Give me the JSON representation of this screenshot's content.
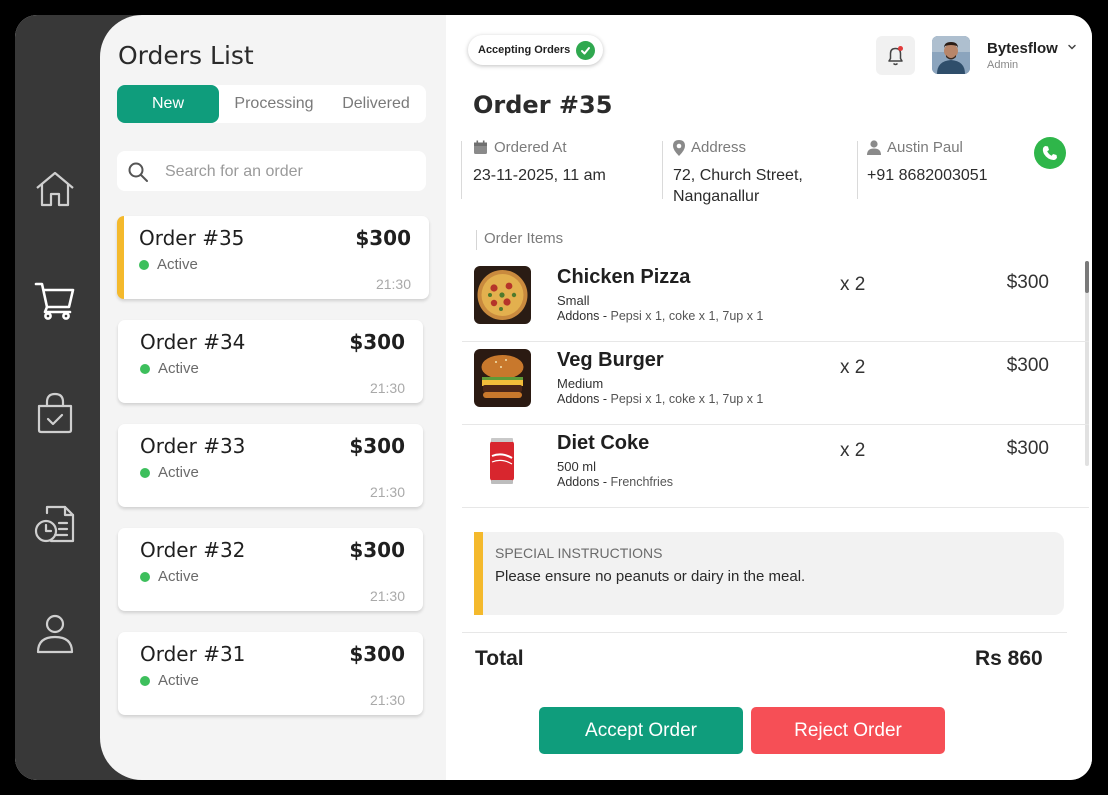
{
  "nav": {
    "items": [
      "home",
      "cart",
      "bag",
      "reports",
      "profile"
    ]
  },
  "orders_list": {
    "title": "Orders List",
    "tabs": [
      {
        "label": "New",
        "active": true
      },
      {
        "label": "Processing",
        "active": false
      },
      {
        "label": "Delivered",
        "active": false
      }
    ],
    "search_placeholder": "Search for an order",
    "orders": [
      {
        "title": "Order #35",
        "price": "$300",
        "status": "Active",
        "time": "21:30",
        "selected": true
      },
      {
        "title": "Order #34",
        "price": "$300",
        "status": "Active",
        "time": "21:30",
        "selected": false
      },
      {
        "title": "Order #33",
        "price": "$300",
        "status": "Active",
        "time": "21:30",
        "selected": false
      },
      {
        "title": "Order #32",
        "price": "$300",
        "status": "Active",
        "time": "21:30",
        "selected": false
      },
      {
        "title": "Order #31",
        "price": "$300",
        "status": "Active",
        "time": "21:30",
        "selected": false
      }
    ]
  },
  "header": {
    "accepting_label": "Accepting Orders",
    "user_name": "Bytesflow",
    "user_role": "Admin"
  },
  "detail": {
    "order_title": "Order #35",
    "ordered_at_label": "Ordered At",
    "ordered_at_value": "23-11-2025, 11 am",
    "address_label": "Address",
    "address_line1": "72, Church Street,",
    "address_line2": "Nanganallur",
    "customer_name": "Austin Paul",
    "customer_phone": "+91 8682003051",
    "items_label": "Order Items",
    "items": [
      {
        "name": "Chicken Pizza",
        "size": "Small",
        "addons_label": "Addons -",
        "addons": "Pepsi x 1,  coke x 1, 7up x 1",
        "qty": "x 2",
        "price": "$300"
      },
      {
        "name": "Veg Burger",
        "size": "Medium",
        "addons_label": "Addons -",
        "addons": "Pepsi x 1,  coke x 1, 7up x 1",
        "qty": "x 2",
        "price": "$300"
      },
      {
        "name": "Diet Coke",
        "size": "500 ml",
        "addons_label": "Addons -",
        "addons": "Frenchfries",
        "qty": "x 2",
        "price": "$300"
      }
    ],
    "special_heading": "SPECIAL INSTRUCTIONS",
    "special_text": "Please ensure no peanuts or dairy in the meal.",
    "total_label": "Total",
    "total_value": "Rs 860",
    "accept_label": "Accept Order",
    "reject_label": "Reject Order"
  },
  "colors": {
    "primary": "#0f9d7c",
    "reject": "#f64f56",
    "highlight": "#f4b92c",
    "active_dot": "#3dbf5c",
    "sidebar": "#383838"
  }
}
